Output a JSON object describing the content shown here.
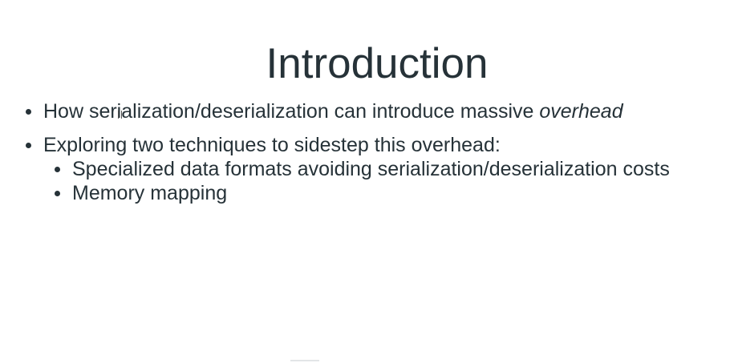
{
  "slide": {
    "title": "Introduction",
    "bullets": [
      {
        "text": "How serialization/deserialization can introduce massive ",
        "emphasis": "overhead"
      },
      {
        "text": "Exploring two techniques to sidestep this overhead:",
        "sub_bullets": [
          "Specialized data formats avoiding serialization/deserialization costs",
          "Memory mapping"
        ]
      }
    ]
  },
  "colors": {
    "text": "#263238",
    "background": "#ffffff"
  }
}
